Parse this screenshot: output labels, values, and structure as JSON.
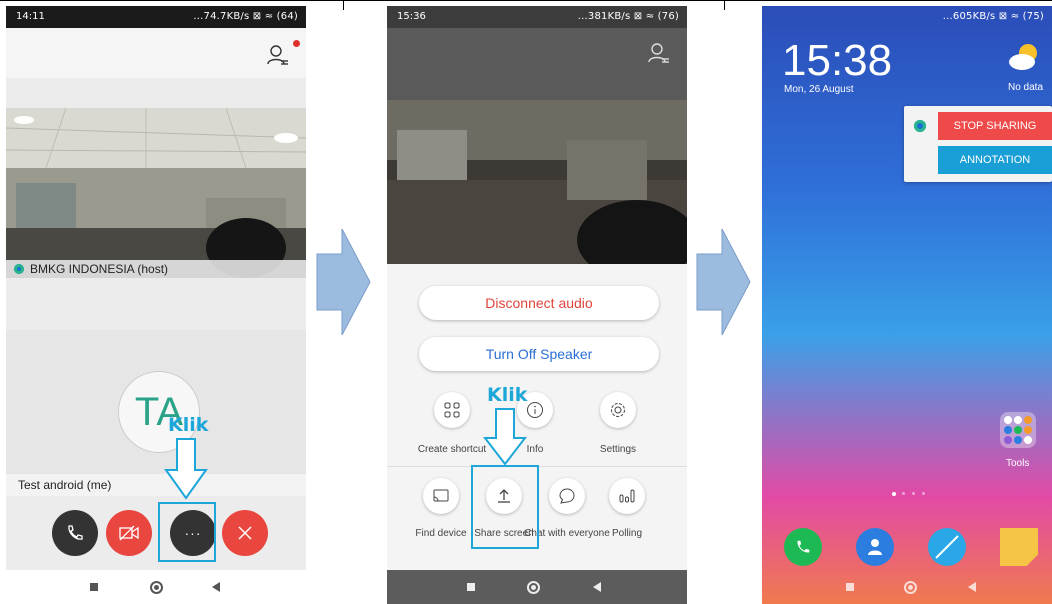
{
  "panel1": {
    "status": {
      "time": "14:11",
      "indicators": "...74.7KB/s ⊠ ≈ (64)"
    },
    "host_label": "BMKG INDONESIA (host)",
    "avatar_initials": "TA",
    "self_label": "Test android (me)",
    "annotation": "Klik",
    "icons": [
      "participants-icon",
      "phone-icon",
      "video-off-icon",
      "more-icon",
      "close-icon"
    ],
    "colors": {
      "header_bg": "#f3f3f3",
      "video_red": "#e8463f",
      "dark_button": "#333333",
      "annotation": "#1da6d8"
    }
  },
  "panel2": {
    "status": {
      "time": "15:36",
      "indicators": "...381KB/s ⊠ ≈ (76)"
    },
    "disconnect_audio": "Disconnect audio",
    "turn_off_speaker": "Turn Off Speaker",
    "annotation": "Klik",
    "options_row1": [
      {
        "icon": "grid-icon",
        "label": "Create shortcut"
      },
      {
        "icon": "info-icon",
        "label": "Info"
      },
      {
        "icon": "settings-icon",
        "label": "Settings"
      }
    ],
    "options_row2": [
      {
        "icon": "cast-icon",
        "label": "Find device"
      },
      {
        "icon": "upload-icon",
        "label": "Share screen"
      },
      {
        "icon": "chat-icon",
        "label": "Chat with everyone"
      },
      {
        "icon": "poll-icon",
        "label": "Polling"
      }
    ],
    "colors": {
      "disconnect_text": "#e0453c",
      "speaker_text": "#2b6fd6"
    }
  },
  "panel3": {
    "status": {
      "indicators": "...605KB/s ⊠ ≈ (75)"
    },
    "clock": "15:38",
    "date": "Mon, 26 August",
    "weather": "No data",
    "stop_sharing": "STOP SHARING",
    "annotation_btn": "ANNOTATION",
    "tools_label": "Tools",
    "dock": [
      "phone-app-icon",
      "contacts-app-icon",
      "browser-app-icon",
      "notes-app-icon"
    ],
    "colors": {
      "stop_bg": "#ef4a4a",
      "annotation_bg": "#1a9ed6",
      "phone": "#1db954",
      "contacts": "#2b7de0",
      "browser": "#29a7e6",
      "notes": "#f6c545"
    }
  }
}
